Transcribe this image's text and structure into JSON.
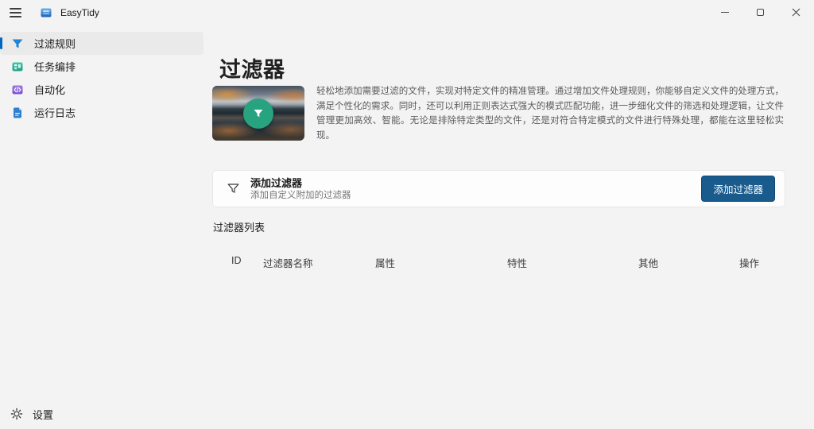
{
  "window": {
    "title": "EasyTidy"
  },
  "sidebar": {
    "items": [
      {
        "label": "过滤规则",
        "icon": "filter-icon",
        "selected": true
      },
      {
        "label": "任务编排",
        "icon": "tasks-icon",
        "selected": false
      },
      {
        "label": "自动化",
        "icon": "automation-icon",
        "selected": false
      },
      {
        "label": "运行日志",
        "icon": "logs-icon",
        "selected": false
      }
    ],
    "settings_label": "设置"
  },
  "main": {
    "page_title": "过滤器",
    "description": "轻松地添加需要过滤的文件，实现对特定文件的精准管理。通过增加文件处理规则，你能够自定义文件的处理方式，满足个性化的需求。同时，还可以利用正则表达式强大的模式匹配功能，进一步细化文件的筛选和处理逻辑，让文件管理更加高效、智能。无论是排除特定类型的文件，还是对符合特定模式的文件进行特殊处理，都能在这里轻松实现。",
    "card": {
      "title": "添加过滤器",
      "subtitle": "添加自定义附加的过滤器",
      "button_label": "添加过滤器"
    },
    "list_label": "过滤器列表",
    "table": {
      "headers": [
        "ID",
        "过滤器名称",
        "属性",
        "特性",
        "其他",
        "操作"
      ],
      "rows": []
    }
  },
  "icons": {
    "titlebar": [
      "hamburger-menu-icon",
      "app-logo-icon",
      "minimize-icon",
      "maximize-icon",
      "close-icon"
    ],
    "sidebar": [
      "filter-icon",
      "tasks-icon",
      "automation-icon",
      "logs-icon",
      "gear-icon"
    ],
    "content": [
      "hero-filter-badge-icon",
      "funnel-outline-icon"
    ]
  },
  "colors": {
    "window_background": "#f3f3f3",
    "accent_selection": "#0067c0",
    "nav_filter_blue": "#1e87d5",
    "tasks_teal": "#2bb59a",
    "automation_purple": "#8a67d8",
    "logs_blue": "#2e7fd0",
    "hero_badge_teal": "#27a37f",
    "button_blue": "#1a5b8e",
    "card_background": "#fdfdfd"
  }
}
